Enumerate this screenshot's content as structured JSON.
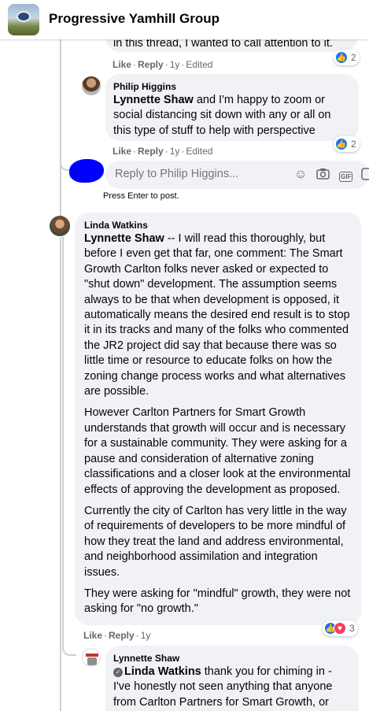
{
  "header": {
    "group_name": "Progressive Yamhill Group"
  },
  "comments": {
    "c0": {
      "text_tail": "in this thread, I wanted to call attention to it.",
      "actions": {
        "like": "Like",
        "reply": "Reply",
        "age": "1y",
        "edited": "Edited"
      },
      "reactions": {
        "count": "2"
      }
    },
    "c1": {
      "author": "Philip Higgins",
      "mention": "Lynnette Shaw",
      "text": " and I'm happy to zoom or social distancing sit down with any or all on this type of stuff to help with perspective",
      "actions": {
        "like": "Like",
        "reply": "Reply",
        "age": "1y",
        "edited": "Edited"
      },
      "reactions": {
        "count": "2"
      }
    },
    "c2": {
      "author": "Linda Watkins",
      "mention": "Lynnette Shaw",
      "p1": " -- I will read this thoroughly, but before I even get that far, one comment: The Smart Growth Carlton folks never asked or expected to \"shut down\" development. The assumption seems always to be that when development is opposed, it automatically means the desired end result is to stop it in its tracks and many of the folks who commented the JR2 project did say that because there was so little time or resource to educate folks on how the zoning change process works and what alternatives are possible.",
      "p2": "However Carlton Partners for Smart Growth understands that growth will occur and is necessary for a sustainable community. They were asking for a pause and consideration of alternative zoning classifications and a closer look at the environmental effects of approving the development as proposed.",
      "p3": "Currently the city of Carlton has very little in the way of requirements of developers to be more mindful of how they treat the land and address environmental, and neighborhood assimilation and integration issues.",
      "p4": "They were asking for \"mindful\" growth, they were not asking for \"no growth.\"",
      "actions": {
        "like": "Like",
        "reply": "Reply",
        "age": "1y"
      },
      "reactions": {
        "count": "3"
      }
    },
    "c3": {
      "author": "Lynnette Shaw",
      "mention": "Linda Watkins",
      "text": " thank you for chiming in - I've honestly not seen anything that anyone from Carlton Partners for Smart Growth, or"
    }
  },
  "reply_box": {
    "placeholder": "Reply to Philip Higgins...",
    "gif_label": "GIF",
    "hint": "Press Enter to post."
  },
  "icons": {
    "like": "thumbs-up-icon",
    "love": "heart-icon",
    "emoji": "emoji-icon",
    "camera": "camera-icon",
    "gif": "gif-icon",
    "sticker": "sticker-icon"
  },
  "colors": {
    "like_blue": "#1877f2",
    "love_red": "#f33e58",
    "bubble": "#f0f2f5",
    "meta": "#65676b"
  }
}
